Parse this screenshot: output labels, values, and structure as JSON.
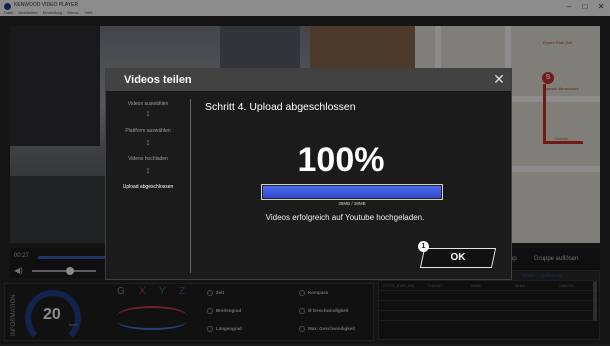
{
  "window": {
    "title": "KENWOOD VIDEO PLAYER",
    "menu": [
      "Datei",
      "Bearbeiten",
      "Einstellung",
      "Werkz.",
      "Hilfe"
    ],
    "controls": {
      "minimize": "–",
      "maximize": "□",
      "close": "✕"
    }
  },
  "player": {
    "time": "00:27",
    "volume_icon": "◀)"
  },
  "map": {
    "pin_label": "S",
    "labels": [
      "Bryant Park Grill",
      "Spanish Benevolent",
      "Lincoln"
    ]
  },
  "right_tabs": {
    "group_label": "Gruppe auflösen",
    "sub_label": "up"
  },
  "info_panel": {
    "vertical_label": "INFORMATION",
    "speed": "20",
    "speed_unit": "km/h",
    "axes": [
      "G",
      "X",
      "Y",
      "Z"
    ],
    "stats": {
      "time": "Zeit",
      "latitude": "Breitengrad",
      "longitude": "Längengrad",
      "compass": "Kompass",
      "avg_speed": "Ø Geschwindigkeit",
      "max_speed": "Max. Geschwindigkeit"
    }
  },
  "table": {
    "headers": [
      "Datei",
      "Auflösung"
    ],
    "rows": [
      [
        "CTYTG_STAR_018",
        "7/19/2017",
        "00055",
        "54 km",
        "1280/720"
      ]
    ]
  },
  "dialog": {
    "title": "Videos teilen",
    "close": "✕",
    "steps": [
      "Videos auswählen",
      "Plattform auswählen",
      "Videos hochladen",
      "Upload abgeschlossen"
    ],
    "active_step": 3,
    "heading": "Schritt 4. Upload abgeschlossen",
    "percent_text": "100%",
    "progress": 1.0,
    "size_text": "38MB / 38MB",
    "message": "Videos erfolgreich auf Youtube hochgeladen.",
    "ok_label": "OK",
    "callout_number": "1"
  }
}
